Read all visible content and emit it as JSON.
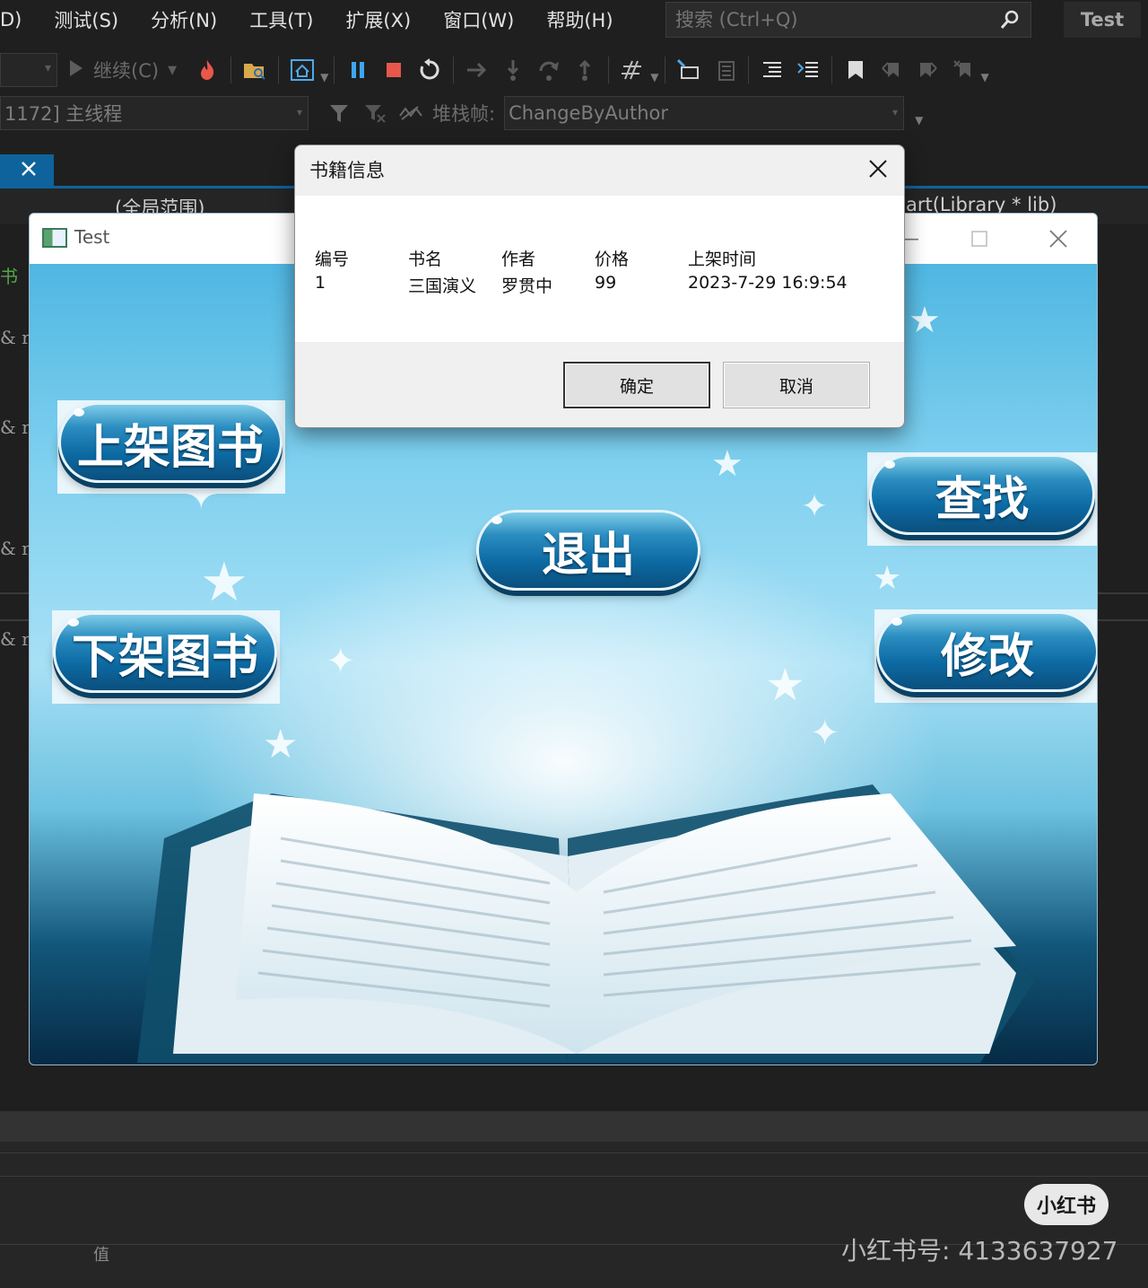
{
  "menu": {
    "items": [
      "D)",
      "测试(S)",
      "分析(N)",
      "工具(T)",
      "扩展(X)",
      "窗口(W)",
      "帮助(H)"
    ],
    "search_placeholder": "搜索 (Ctrl+Q)",
    "app_title": "Test"
  },
  "toolbar": {
    "continue_label": "继续(C)"
  },
  "toolbar2": {
    "thread_combo": "1172] 主线程",
    "stack_label": "堆栈帧:",
    "stack_combo": "ChangeByAuthor"
  },
  "editor": {
    "scope_left": "(全局范围)",
    "scope_right": "art(Library * lib)",
    "gutter": [
      "书",
      "& r",
      "& r",
      "& r",
      "& r"
    ]
  },
  "bottom_panel": {
    "value_label": "值"
  },
  "test_window": {
    "title": "Test",
    "buttons": {
      "add": "上架图书",
      "remove": "下架图书",
      "exit": "退出",
      "find": "查找",
      "modify": "修改"
    }
  },
  "dialog": {
    "title": "书籍信息",
    "headers": [
      "编号",
      "书名",
      "作者",
      "价格",
      "上架时间"
    ],
    "row": [
      "1",
      "三国演义",
      "罗贯中",
      "99",
      "2023-7-29 16:9:54"
    ],
    "ok_label": "确定",
    "cancel_label": "取消"
  },
  "watermark": {
    "badge": "小红书",
    "account": "小红书号: 4133637927"
  },
  "colors": {
    "vs_background": "#1f1f1f",
    "vs_accent": "#0e639c",
    "pill_blue": "#0d6aa3",
    "stop_red": "#e8574a",
    "pause_blue": "#3ea6f2"
  },
  "icons": [
    "search-icon",
    "play-icon",
    "hot-reload-icon",
    "open-folder-icon",
    "home-icon",
    "pause-icon",
    "stop-icon",
    "restart-icon",
    "step-over-icon",
    "step-into-icon",
    "step-out-icon",
    "bookmark-icon",
    "filter-icon",
    "close-icon"
  ]
}
